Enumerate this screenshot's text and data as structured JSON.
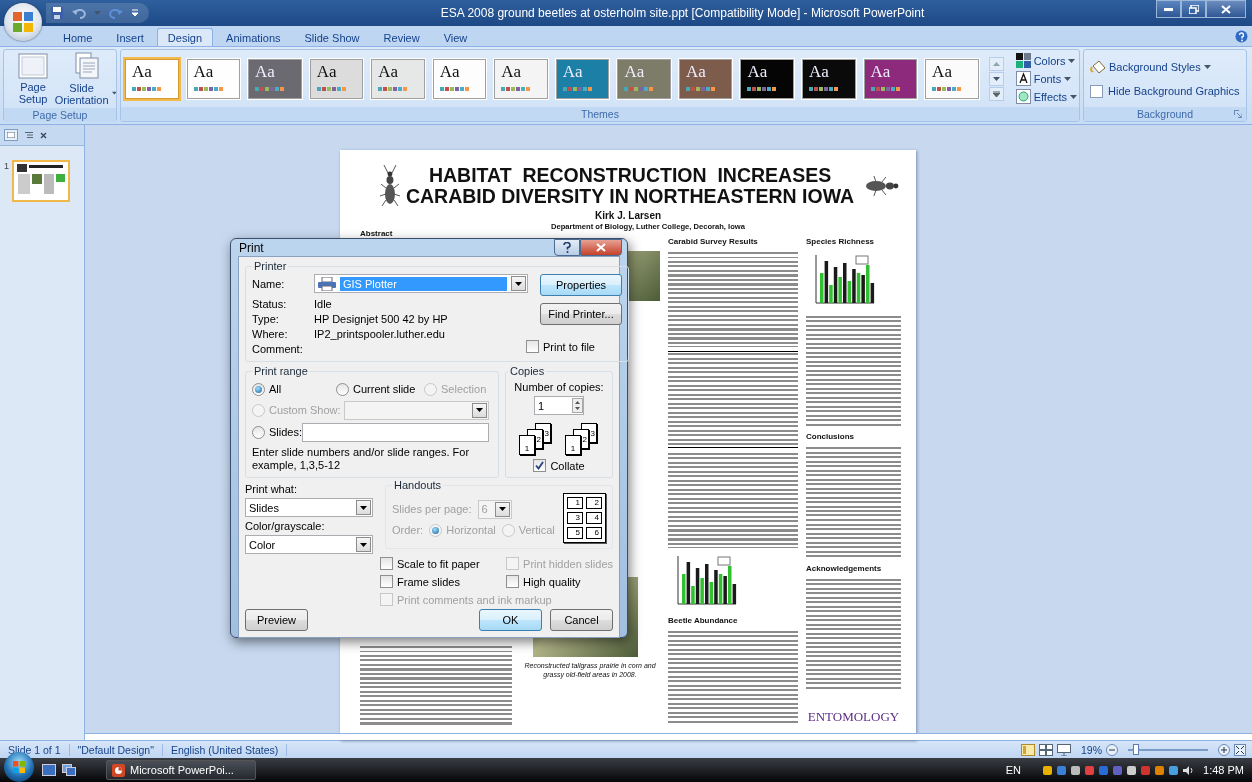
{
  "window": {
    "title": "ESA 2008 ground beetles at osterholm site.ppt [Compatibility Mode] - Microsoft PowerPoint"
  },
  "ribbon_tabs": [
    {
      "label": "Home",
      "selected": false
    },
    {
      "label": "Insert",
      "selected": false
    },
    {
      "label": "Design",
      "selected": true
    },
    {
      "label": "Animations",
      "selected": false
    },
    {
      "label": "Slide Show",
      "selected": false
    },
    {
      "label": "Review",
      "selected": false
    },
    {
      "label": "View",
      "selected": false
    }
  ],
  "page_setup_group": {
    "title": "Page Setup",
    "buttons": [
      {
        "label": "Page Setup",
        "kind": "page"
      },
      {
        "label": "Slide Orientation",
        "kind": "orientation"
      }
    ]
  },
  "themes": {
    "title": "Themes",
    "items": [
      {
        "label": "Aa",
        "color": "#ffffff",
        "selected": true
      },
      {
        "label": "Aa",
        "color": "#fefefe",
        "selected": false
      },
      {
        "label": "Aa",
        "color": "#6b6a70",
        "selected": false
      },
      {
        "label": "Aa",
        "color": "#dcdcdc",
        "selected": false
      },
      {
        "label": "Aa",
        "color": "#e6e8e8",
        "selected": false
      },
      {
        "label": "Aa",
        "color": "#fdfdfd",
        "selected": false
      },
      {
        "label": "Aa",
        "color": "#f4f4f4",
        "selected": false
      },
      {
        "label": "Aa",
        "color": "#1c7fa6",
        "selected": false
      },
      {
        "label": "Aa",
        "color": "#7c7c68",
        "selected": false
      },
      {
        "label": "Aa",
        "color": "#7e5c4c",
        "selected": false
      },
      {
        "label": "Aa",
        "color": "#050505",
        "selected": false
      },
      {
        "label": "Aa",
        "color": "#0a0a0a",
        "selected": false
      },
      {
        "label": "Aa",
        "color": "#8d2a7c",
        "selected": false
      },
      {
        "label": "Aa",
        "color": "#fbfbfb",
        "selected": false
      }
    ],
    "options": [
      {
        "label": "Colors",
        "kind": "colors"
      },
      {
        "label": "Fonts",
        "kind": "fonts"
      },
      {
        "label": "Effects",
        "kind": "effects"
      }
    ]
  },
  "background_group": {
    "title": "Background",
    "styles_button": "Background Styles",
    "hide_graphics": {
      "label": "Hide Background Graphics",
      "checked": false
    }
  },
  "slides_pane": {
    "thumbnails": [
      {
        "number": "1",
        "selected": true
      }
    ]
  },
  "slide": {
    "title_lines": [
      "HABITAT  RECONSTRUCTION  INCREASES",
      "CARABID DIVERSITY IN NORTHEASTERN IOWA"
    ],
    "author": "Kirk J. Larsen",
    "affiliation": "Department of Biology, Luther College, Decorah, Iowa",
    "columns": [
      {
        "blocks": [
          {
            "kind": "heading",
            "text": "Abstract"
          },
          {
            "kind": "gap"
          },
          {
            "kind": "text"
          }
        ]
      },
      {
        "blocks": [
          {
            "kind": "gap_small"
          },
          {
            "kind": "photo"
          },
          {
            "kind": "gap"
          },
          {
            "kind": "photo_large"
          },
          {
            "kind": "caption",
            "text": "Reconstructed tallgrass prairie in corn and grassy old-field areas in 2008."
          }
        ]
      },
      {
        "blocks": [
          {
            "kind": "heading",
            "text": "Carabid Survey Results"
          },
          {
            "kind": "text"
          },
          {
            "kind": "table"
          },
          {
            "kind": "text"
          },
          {
            "kind": "chart"
          },
          {
            "kind": "heading",
            "text": "Beetle Abundance"
          },
          {
            "kind": "text"
          }
        ]
      },
      {
        "blocks": [
          {
            "kind": "heading",
            "text": "Species Richness"
          },
          {
            "kind": "chart"
          },
          {
            "kind": "text"
          },
          {
            "kind": "heading",
            "text": "Conclusions"
          },
          {
            "kind": "text"
          },
          {
            "kind": "heading",
            "text": "Acknowledgements"
          },
          {
            "kind": "text"
          },
          {
            "kind": "logo",
            "text": "ENTOMOLOGY"
          }
        ]
      }
    ]
  },
  "print_dialog": {
    "title": "Print",
    "printer": {
      "group": "Printer",
      "name_label": "Name:",
      "name": "GIS Plotter",
      "properties": "Properties",
      "find_printer": "Find Printer...",
      "details": [
        {
          "label": "Status:",
          "value": "Idle"
        },
        {
          "label": "Type:",
          "value": "HP Designjet 500 42 by HP"
        },
        {
          "label": "Where:",
          "value": "IP2_printspooler.luther.edu"
        },
        {
          "label": "Comment:"
        }
      ],
      "print_to_file": {
        "label": "Print to file",
        "checked": false
      }
    },
    "print_range": {
      "group": "Print range",
      "options": [
        {
          "label": "All",
          "selected": true,
          "disabled": false
        },
        {
          "label": "Current slide",
          "selected": false,
          "disabled": false
        },
        {
          "label": "Selection",
          "selected": false,
          "disabled": true
        },
        {
          "label": "Custom Show:",
          "selected": false,
          "disabled": true
        },
        {
          "label": "Slides:",
          "selected": false,
          "disabled": false
        }
      ],
      "hint": "Enter slide numbers and/or slide ranges. For example, 1,3,5-12"
    },
    "copies": {
      "group": "Copies",
      "label": "Number of copies:",
      "value": "1",
      "stacks": [
        [
          "1",
          "2",
          "3"
        ],
        [
          "1",
          "2",
          "3"
        ]
      ],
      "collate": {
        "label": "Collate",
        "checked": true
      }
    },
    "print_what": {
      "label": "Print what:",
      "value": "Slides"
    },
    "color_mode": {
      "label": "Color/grayscale:",
      "value": "Color"
    },
    "handouts": {
      "group": "Handouts",
      "disabled": true,
      "slides_per_page_label": "Slides per page:",
      "slides_per_page": "6",
      "order_label": "Order:",
      "orders": [
        {
          "label": "Horizontal",
          "selected": true
        },
        {
          "label": "Vertical",
          "selected": false
        }
      ],
      "preview": [
        "1",
        "2",
        "3",
        "4",
        "5",
        "6"
      ]
    },
    "options": [
      {
        "label": "Scale to fit paper",
        "checked": false,
        "disabled": false
      },
      {
        "label": "Print hidden slides",
        "checked": false,
        "disabled": true
      },
      {
        "label": "Frame slides",
        "checked": false,
        "disabled": false
      },
      {
        "label": "High quality",
        "checked": false,
        "disabled": false
      },
      {
        "label": "Print comments and ink markup",
        "checked": false,
        "disabled": true
      }
    ],
    "buttons": [
      {
        "label": "Preview",
        "kind": "preview"
      },
      {
        "label": "OK",
        "kind": "default"
      },
      {
        "label": "Cancel",
        "kind": "normal"
      }
    ]
  },
  "status_bar": {
    "slide": "Slide 1 of 1",
    "theme": "\"Default Design\"",
    "language": "English (United States)",
    "zoom": "19%",
    "zoom_slider": {
      "level": 0.1
    }
  },
  "taskbar": {
    "task": "Microsoft PowerPoi...",
    "language": "EN",
    "clock": "1:48 PM"
  }
}
